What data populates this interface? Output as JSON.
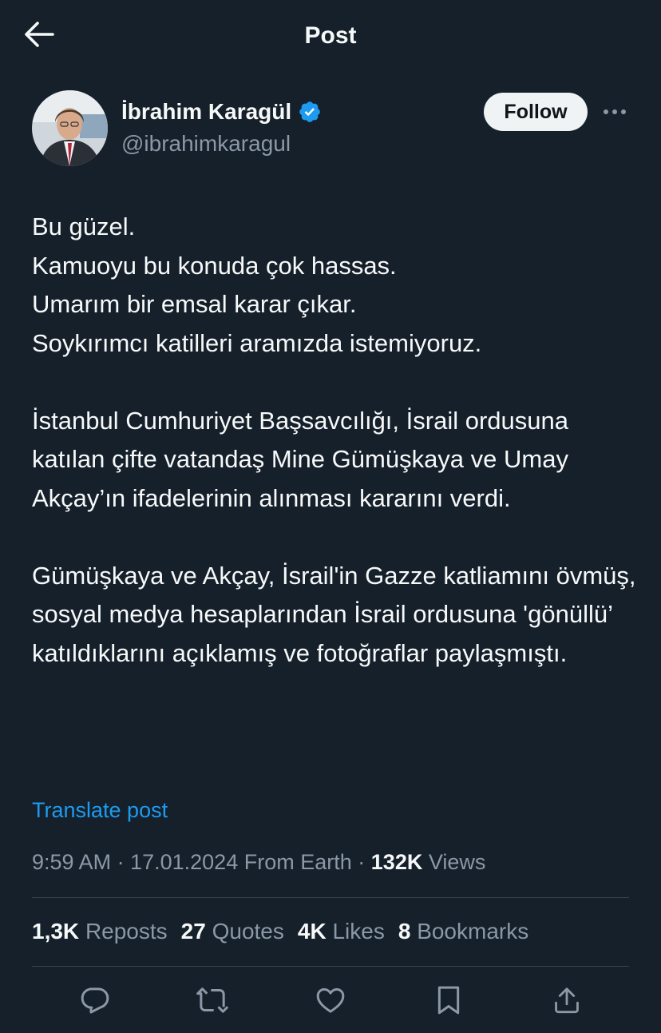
{
  "header": {
    "title": "Post"
  },
  "author": {
    "display_name": "İbrahim Karagül",
    "handle": "@ibrahimkaragul",
    "follow_label": "Follow"
  },
  "post": {
    "text": "Bu güzel.\nKamuoyu bu konuda çok hassas.\nUmarım bir emsal karar çıkar.\nSoykırımcı katilleri aramızda istemiyoruz.\n\nİstanbul Cumhuriyet Başsavcılığı, İsrail ordusuna katılan çifte vatandaş Mine Gümüşkaya ve Umay Akçay’ın ifadelerinin alınması kararını verdi.\n\nGümüşkaya ve Akçay, İsrail'in Gazze katliamını övmüş, sosyal medya hesaplarından İsrail ordusuna 'gönüllü’ katıldıklarını açıklamış ve fotoğraflar paylaşmıştı.",
    "translate_label": "Translate post",
    "time": "9:59 AM",
    "date": "17.01.2024",
    "source": "From Earth",
    "views_count": "132K",
    "views_label": "Views"
  },
  "stats": {
    "reposts_count": "1,3K",
    "reposts_label": "Reposts",
    "quotes_count": "27",
    "quotes_label": "Quotes",
    "likes_count": "4K",
    "likes_label": "Likes",
    "bookmarks_count": "8",
    "bookmarks_label": "Bookmarks"
  },
  "icons": {
    "back": "arrow-left-icon",
    "verified": "verified-badge-icon",
    "more": "more-horizontal-icon",
    "reply": "reply-icon",
    "repost": "repost-icon",
    "like": "heart-icon",
    "bookmark": "bookmark-icon",
    "share": "share-icon"
  },
  "colors": {
    "background": "#15202b",
    "text": "#f7f9f9",
    "secondary_text": "#8b98a5",
    "accent": "#1d9bf0",
    "divider": "#38444d",
    "follow_bg": "#eff3f4"
  }
}
